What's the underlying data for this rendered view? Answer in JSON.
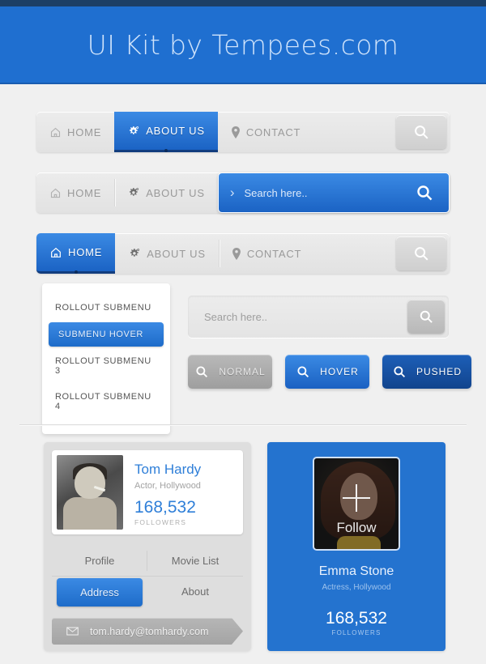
{
  "header": {
    "title": "UI Kit by Tempees.com",
    "banner_color": "#1f6fd0",
    "strip_color": "#1c3f66"
  },
  "nav1": {
    "items": [
      {
        "label": "HOME",
        "icon": "home-icon",
        "active": false
      },
      {
        "label": "ABOUT US",
        "icon": "gear-icon",
        "active": true
      },
      {
        "label": "CONTACT",
        "icon": "pin-icon",
        "active": false
      }
    ],
    "search_icon": "search-icon"
  },
  "nav2": {
    "items": [
      {
        "label": "HOME",
        "icon": "home-icon"
      },
      {
        "label": "ABOUT US",
        "icon": "gear-icon"
      }
    ],
    "search_placeholder": "Search here..",
    "chevron": "›",
    "search_icon": "search-icon"
  },
  "nav3": {
    "items": [
      {
        "label": "HOME",
        "icon": "home-icon",
        "active": true
      },
      {
        "label": "ABOUT US",
        "icon": "gear-icon",
        "active": false
      },
      {
        "label": "CONTACT",
        "icon": "pin-icon",
        "active": false
      }
    ],
    "search_icon": "search-icon"
  },
  "submenu": {
    "items": [
      {
        "label": "ROLLOUT SUBMENU",
        "state": "normal"
      },
      {
        "label": "SUBMENU HOVER",
        "state": "hover"
      },
      {
        "label": "ROLLOUT SUBMENU 3",
        "state": "normal"
      },
      {
        "label": "ROLLOUT SUBMENU 4",
        "state": "normal"
      }
    ]
  },
  "searchbox": {
    "placeholder": "Search here..",
    "value": "",
    "button_icon": "search-icon"
  },
  "buttons": [
    {
      "label": "NORMAL",
      "state": "normal",
      "icon": "search-icon",
      "color": "#9e9e9e"
    },
    {
      "label": "HOVER",
      "state": "hover",
      "icon": "search-icon",
      "color": "#1a61c2"
    },
    {
      "label": "PUSHED",
      "state": "pushed",
      "icon": "search-icon",
      "color": "#11448d"
    }
  ],
  "profile_card": {
    "name": "Tom Hardy",
    "role": "Actor, Hollywood",
    "followers_count": "168,532",
    "followers_label": "FOLLOWERS",
    "tabs": [
      {
        "label": "Profile",
        "active": false
      },
      {
        "label": "Movie List",
        "active": false
      },
      {
        "label": "Address",
        "active": true
      },
      {
        "label": "About",
        "active": false
      }
    ],
    "email": "tom.hardy@tomhardy.com",
    "email_icon": "envelope-icon",
    "accent_color": "#2f7fd8"
  },
  "follow_card": {
    "name": "Emma Stone",
    "role": "Actress, Hollywood",
    "followers_count": "168,532",
    "followers_label": "FOLLOWERS",
    "follow_label": "Follow",
    "follow_icon": "plus-icon",
    "background_color": "#2473cf"
  }
}
